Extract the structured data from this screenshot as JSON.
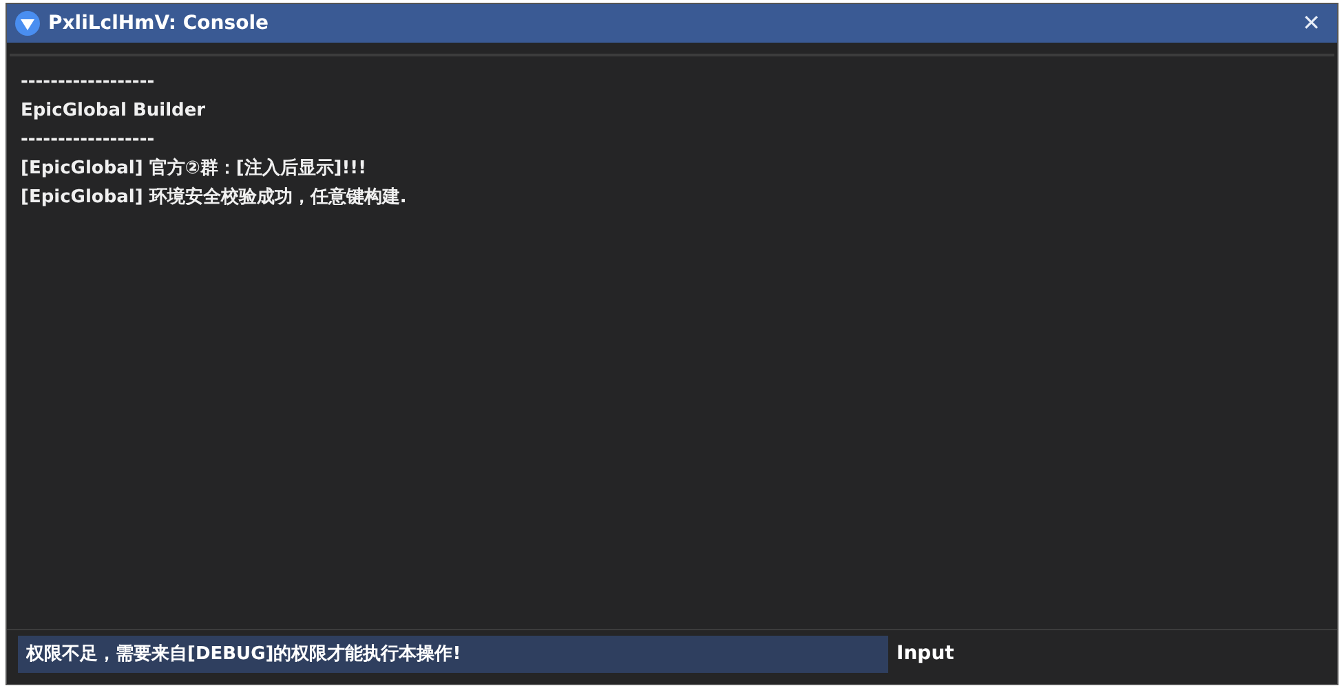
{
  "window": {
    "title": "PxliLclHmV: Console",
    "close": "✕"
  },
  "console": {
    "lines": [
      "------------------",
      "EpicGlobal Builder",
      "------------------",
      "[EpicGlobal] 官方②群：[注入后显示]!!!",
      "[EpicGlobal] 环境安全校验成功，任意键构建."
    ]
  },
  "input": {
    "value": "权限不足，需要来自[DEBUG]的权限才能执行本操作!",
    "label": "Input"
  }
}
